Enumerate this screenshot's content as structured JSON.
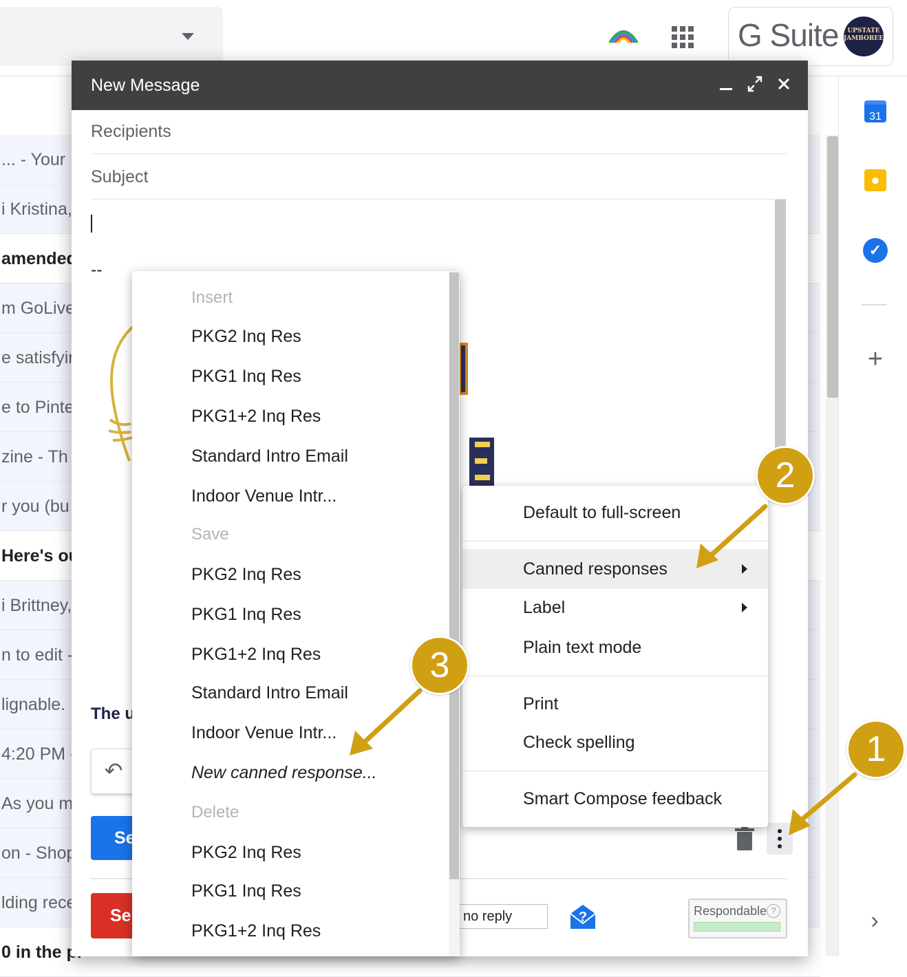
{
  "topbar": {
    "brand": "G Suite",
    "avatar_text": "UPSTATE JAMBOREE"
  },
  "inbox": {
    "rows": [
      {
        "text": "... - Your",
        "unread": false
      },
      {
        "text": "i Kristina,",
        "unread": false
      },
      {
        "text": "amended!",
        "unread": true
      },
      {
        "text": "m GoLive",
        "unread": false
      },
      {
        "text": "e satisfyin",
        "unread": false
      },
      {
        "text": "e to Pinte",
        "unread": false
      },
      {
        "text": "zine - Th",
        "unread": false
      },
      {
        "text": "r you (bu",
        "unread": false
      },
      {
        "text": " Here's ou",
        "unread": true
      },
      {
        "text": "i Brittney,",
        "unread": false
      },
      {
        "text": "n to edit -",
        "unread": false
      },
      {
        "text": "lignable.",
        "unread": false
      },
      {
        "text": "4:20 PM -",
        "unread": false
      },
      {
        "text": "As you ma",
        "unread": false
      },
      {
        "text": "on - Shop",
        "unread": false
      },
      {
        "text": "lding rece",
        "unread": false
      },
      {
        "text": "0 in the pr",
        "unread": true
      }
    ]
  },
  "side_panel": {
    "calendar_day": "31"
  },
  "compose": {
    "title": "New Message",
    "recipients_placeholder": "Recipients",
    "subject_placeholder": "Subject",
    "signature_dash": "--",
    "body_partial": "The u",
    "send_blue": "Se",
    "send_red": "Se",
    "no_reply": "no reply",
    "respondable": "Respondable"
  },
  "more_menu": {
    "items": [
      "Default to full-screen",
      "Canned responses",
      "Label",
      "Plain text mode",
      "Print",
      "Check spelling",
      "Smart Compose feedback"
    ]
  },
  "canned_menu": {
    "insert_header": "Insert",
    "insert_items": [
      "PKG2 Inq Res",
      "PKG1 Inq Res",
      "PKG1+2 Inq Res",
      "Standard Intro Email",
      "Indoor Venue Intr..."
    ],
    "save_header": "Save",
    "save_items": [
      "PKG2 Inq Res",
      "PKG1 Inq Res",
      "PKG1+2 Inq Res",
      "Standard Intro Email",
      "Indoor Venue Intr..."
    ],
    "new_canned": "New canned response...",
    "delete_header": "Delete",
    "delete_items": [
      "PKG2 Inq Res",
      "PKG1 Inq Res",
      "PKG1+2 Inq Res"
    ]
  },
  "annotations": {
    "step1": "1",
    "step2": "2",
    "step3": "3",
    "color": "#d19f12"
  }
}
